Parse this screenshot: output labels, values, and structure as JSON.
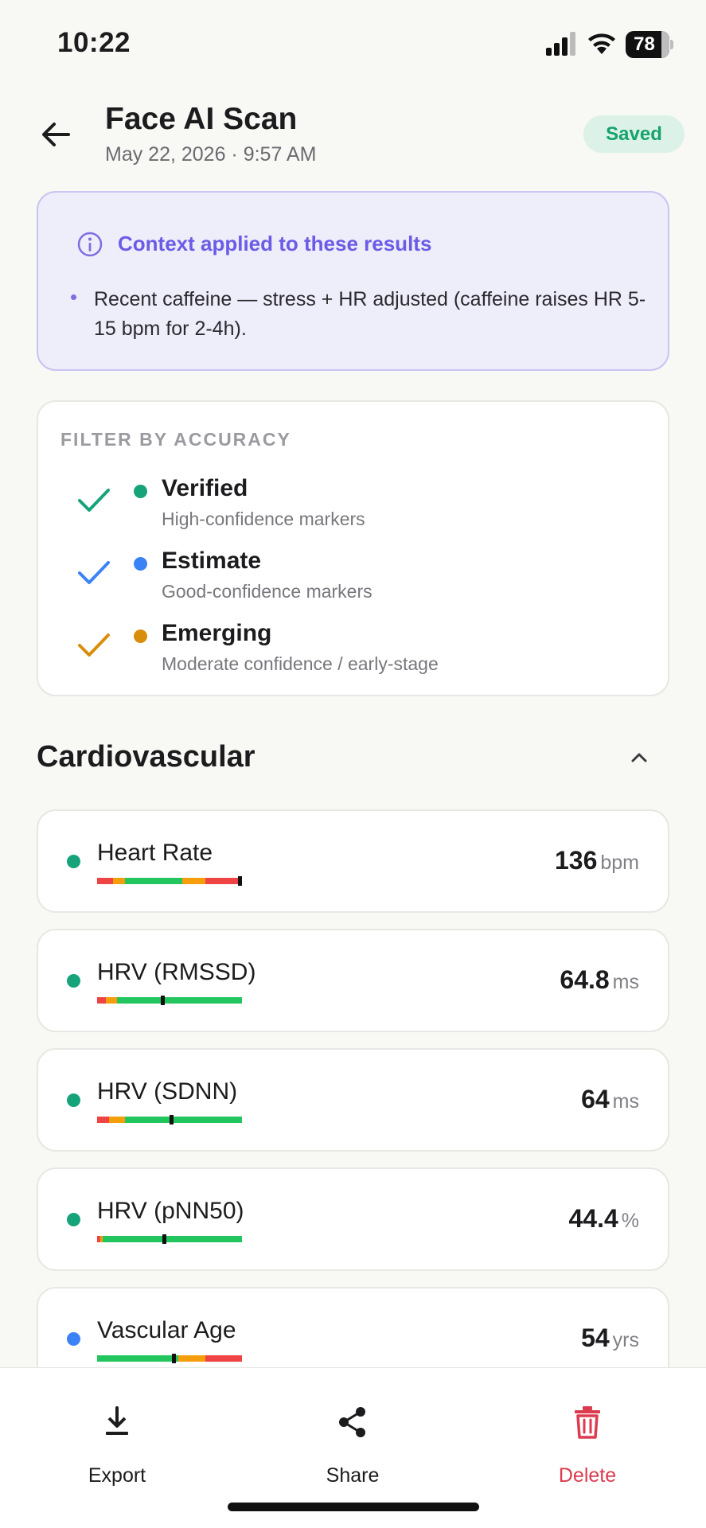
{
  "status_bar": {
    "time": "10:22",
    "battery": "78"
  },
  "header": {
    "title": "Face AI Scan",
    "subtitle": "May 22, 2026 · 9:57 AM",
    "badge": "Saved"
  },
  "context": {
    "title": "Context applied to these results",
    "bullet": "Recent caffeine — stress + HR adjusted (caffeine raises HR 5-15 bpm for 2-4h)."
  },
  "filter": {
    "heading": "FILTER BY ACCURACY",
    "options": [
      {
        "label": "Verified",
        "description": "High-confidence markers",
        "color": "#16a37a",
        "checked": true
      },
      {
        "label": "Estimate",
        "description": "Good-confidence markers",
        "color": "#3b82f6",
        "checked": true
      },
      {
        "label": "Emerging",
        "description": "Moderate confidence / early-stage",
        "color": "#d98e0b",
        "checked": true
      }
    ]
  },
  "section": {
    "title": "Cardiovascular",
    "expanded": true
  },
  "metrics": [
    {
      "name": "Heart Rate",
      "value": "136",
      "unit": "bpm",
      "accuracy": "verified",
      "marker_position": 0.99,
      "bar": [
        {
          "c": "#ef4444",
          "w": 0.11
        },
        {
          "c": "#f59e0b",
          "w": 0.08
        },
        {
          "c": "#22c55e",
          "w": 0.4
        },
        {
          "c": "#f59e0b",
          "w": 0.16
        },
        {
          "c": "#ef4444",
          "w": 0.25
        }
      ]
    },
    {
      "name": "HRV (RMSSD)",
      "value": "64.8",
      "unit": "ms",
      "accuracy": "verified",
      "marker_position": 0.45,
      "bar": [
        {
          "c": "#ef4444",
          "w": 0.06
        },
        {
          "c": "#f59e0b",
          "w": 0.08
        },
        {
          "c": "#22c55e",
          "w": 0.86
        }
      ]
    },
    {
      "name": "HRV (SDNN)",
      "value": "64",
      "unit": "ms",
      "accuracy": "verified",
      "marker_position": 0.51,
      "bar": [
        {
          "c": "#ef4444",
          "w": 0.08
        },
        {
          "c": "#f59e0b",
          "w": 0.11
        },
        {
          "c": "#22c55e",
          "w": 0.81
        }
      ]
    },
    {
      "name": "HRV (pNN50)",
      "value": "44.4",
      "unit": "%",
      "accuracy": "verified",
      "marker_position": 0.46,
      "bar": [
        {
          "c": "#ef4444",
          "w": 0.02
        },
        {
          "c": "#f59e0b",
          "w": 0.02
        },
        {
          "c": "#22c55e",
          "w": 0.96
        }
      ]
    },
    {
      "name": "Vascular Age",
      "value": "54",
      "unit": "yrs",
      "accuracy": "estimate",
      "marker_position": 0.53,
      "bar": [
        {
          "c": "#22c55e",
          "w": 0.56
        },
        {
          "c": "#f59e0b",
          "w": 0.19
        },
        {
          "c": "#ef4444",
          "w": 0.25
        }
      ]
    }
  ],
  "accuracy_colors": {
    "verified": "#16a37a",
    "estimate": "#3b82f6",
    "emerging": "#d98e0b"
  },
  "actions": [
    {
      "label": "Export",
      "icon": "download-icon",
      "color": "#1c1c1e"
    },
    {
      "label": "Share",
      "icon": "share-icon",
      "color": "#1c1c1e"
    },
    {
      "label": "Delete",
      "icon": "trash-icon",
      "color": "#dc3b4f"
    }
  ]
}
